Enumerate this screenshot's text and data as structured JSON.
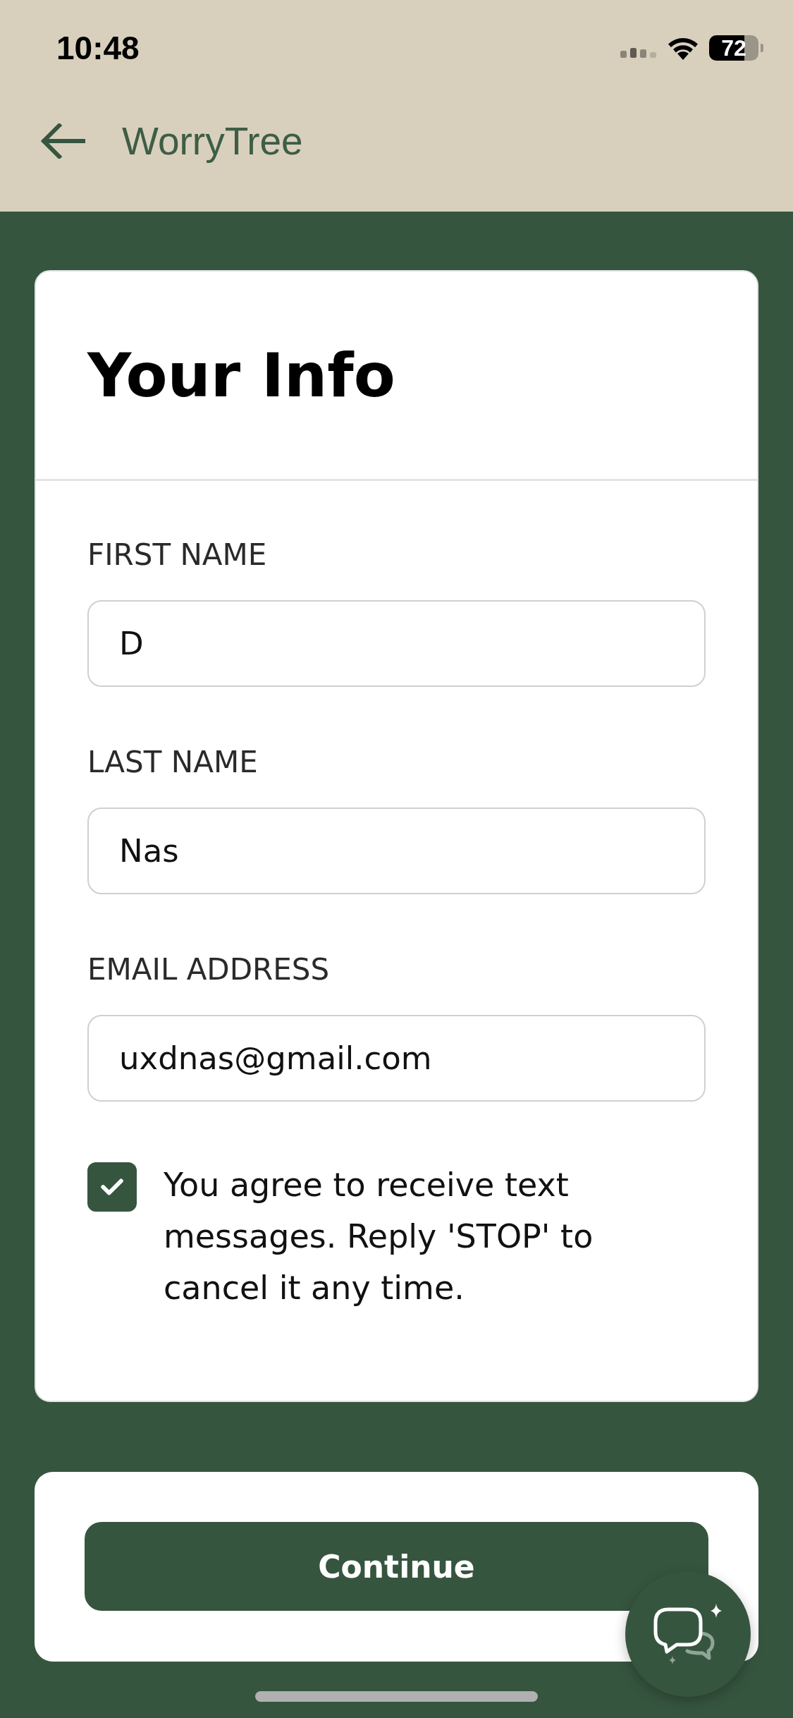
{
  "status_bar": {
    "time": "10:48",
    "battery": "72"
  },
  "header": {
    "title": "WorryTree"
  },
  "form": {
    "title": "Your Info",
    "fields": [
      {
        "label": "FIRST NAME",
        "value": "D"
      },
      {
        "label": "LAST NAME",
        "value": "Nas"
      },
      {
        "label": "EMAIL ADDRESS",
        "value": "uxdnas@gmail.com"
      }
    ],
    "consent": {
      "checked": true,
      "text": "You agree to receive text messages. Reply 'STOP' to cancel it any time."
    }
  },
  "actions": {
    "continue": "Continue"
  }
}
